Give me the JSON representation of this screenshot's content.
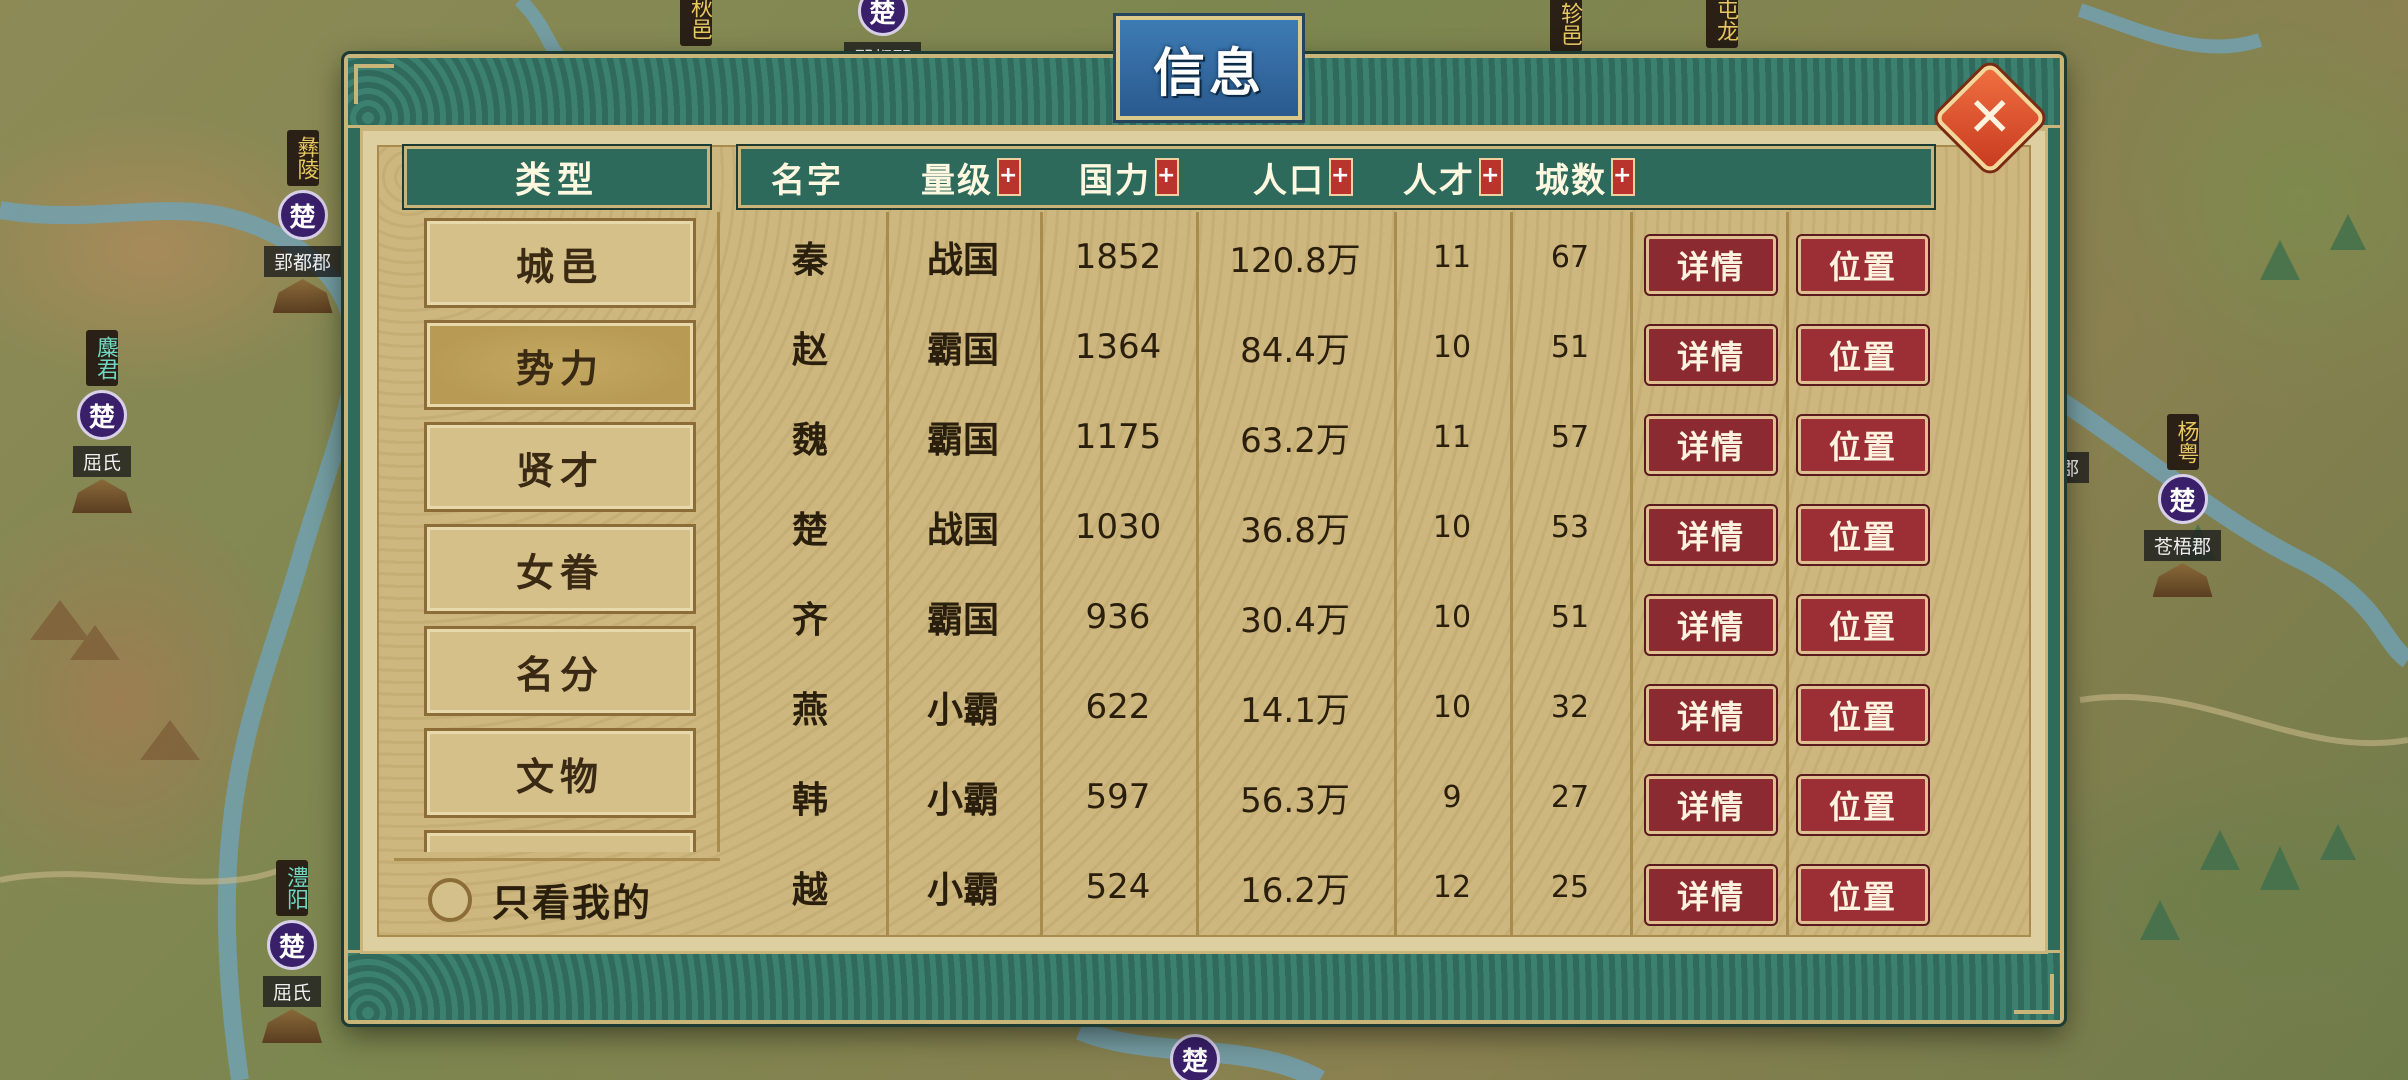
{
  "map": {
    "markers": [
      {
        "banner": "彝陵",
        "seal": "楚",
        "place": "郢都郡",
        "teal": false
      },
      {
        "banner": "麋君",
        "seal": "楚",
        "place": "屈氏",
        "teal": true
      },
      {
        "banner": "澧阳",
        "seal": "楚",
        "place": "屈氏",
        "teal": true
      },
      {
        "banner": "杨粤",
        "seal": "楚",
        "place": "苍梧郡",
        "teal": false
      },
      {
        "banner": "",
        "seal": "楚",
        "place": "郢都郡",
        "teal": false
      },
      {
        "banner": "秋邑",
        "seal": "",
        "place": "",
        "teal": false
      },
      {
        "banner": "轸邑",
        "seal": "",
        "place": "",
        "teal": false
      },
      {
        "banner": "屯龙",
        "seal": "",
        "place": "",
        "teal": false
      },
      {
        "banner": "",
        "seal": "楚",
        "place": "",
        "teal": false
      }
    ],
    "partial_labels": [
      "郡"
    ]
  },
  "dialog": {
    "title": "信息",
    "close_symbol": "✕",
    "category_header": "类型",
    "categories": [
      "城邑",
      "势力",
      "贤才",
      "女眷",
      "名分",
      "文物"
    ],
    "active_category": 1,
    "only_mine_label": "只看我的",
    "columns": [
      {
        "label": "名字",
        "sortable": false
      },
      {
        "label": "量级",
        "sortable": true
      },
      {
        "label": "国力",
        "sortable": true
      },
      {
        "label": "人口",
        "sortable": true
      },
      {
        "label": "人才",
        "sortable": true
      },
      {
        "label": "城数",
        "sortable": true
      }
    ],
    "sort_symbol": "+",
    "detail_label": "详情",
    "position_label": "位置",
    "rows": [
      {
        "name": "秦",
        "level": "战国",
        "power": "1852",
        "population": "120.8万",
        "talent": "11",
        "cities": "67"
      },
      {
        "name": "赵",
        "level": "霸国",
        "power": "1364",
        "population": "84.4万",
        "talent": "10",
        "cities": "51"
      },
      {
        "name": "魏",
        "level": "霸国",
        "power": "1175",
        "population": "63.2万",
        "talent": "11",
        "cities": "57"
      },
      {
        "name": "楚",
        "level": "战国",
        "power": "1030",
        "population": "36.8万",
        "talent": "10",
        "cities": "53"
      },
      {
        "name": "齐",
        "level": "霸国",
        "power": "936",
        "population": "30.4万",
        "talent": "10",
        "cities": "51"
      },
      {
        "name": "燕",
        "level": "小霸",
        "power": "622",
        "population": "14.1万",
        "talent": "10",
        "cities": "32"
      },
      {
        "name": "韩",
        "level": "小霸",
        "power": "597",
        "population": "56.3万",
        "talent": "9",
        "cities": "27"
      },
      {
        "name": "越",
        "level": "小霸",
        "power": "524",
        "population": "16.2万",
        "talent": "12",
        "cities": "25"
      }
    ]
  }
}
